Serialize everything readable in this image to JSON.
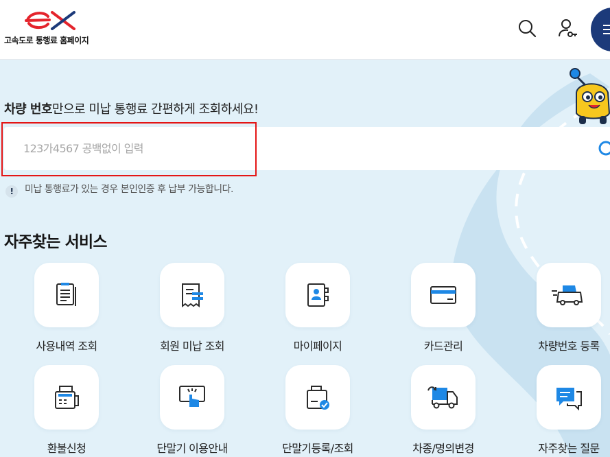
{
  "header": {
    "logo_mark": "ex",
    "site_title": "고속도로 통행료 홈페이지",
    "icons": [
      "search-icon",
      "user-key-icon",
      "menu-icon"
    ]
  },
  "hero": {
    "lead_strong": "차량 번호",
    "lead_rest": "만으로 미납 통행료 간편하게 조회하세요!",
    "search": {
      "placeholder": "123가4567 공백없이 입력",
      "value": ""
    },
    "notice_mark": "!",
    "notice": "미납 통행료가 있는 경우 본인인증 후 납부 가능합니다."
  },
  "services": {
    "title": "자주찾는 서비스",
    "items": [
      {
        "label": "사용내역 조회",
        "icon": "receipt-list-icon"
      },
      {
        "label": "회원 미납 조회",
        "icon": "unpaid-bill-icon"
      },
      {
        "label": "마이페이지",
        "icon": "contact-book-icon"
      },
      {
        "label": "카드관리",
        "icon": "credit-card-icon"
      },
      {
        "label": "차량번호 등록",
        "icon": "car-register-icon"
      },
      {
        "label": "환불신청",
        "icon": "refund-machine-icon"
      },
      {
        "label": "단말기 이용안내",
        "icon": "terminal-touch-icon"
      },
      {
        "label": "단말기등록/조회",
        "icon": "terminal-check-icon"
      },
      {
        "label": "차종/명의변경",
        "icon": "truck-change-icon"
      },
      {
        "label": "자주찾는 질문",
        "icon": "faq-chat-icon"
      }
    ]
  },
  "colors": {
    "brand_red": "#e4242c",
    "navy": "#1c3a7a",
    "accent_blue": "#1e88e5",
    "hero_bg": "#e2f1f9"
  }
}
